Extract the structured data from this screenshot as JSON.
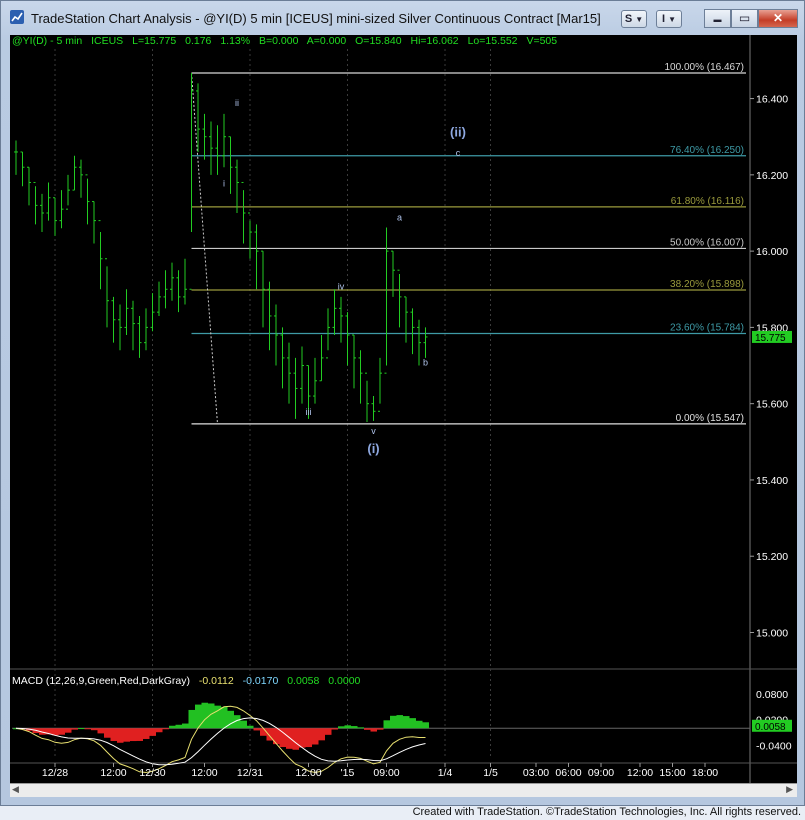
{
  "window": {
    "title": "TradeStation Chart Analysis - @YI(D) 5 min [ICEUS] mini-sized Silver Continuous Contract [Mar15]",
    "toolbar_s_label": "S",
    "toolbar_i_label": "I",
    "minimize_glyph": "▬",
    "maximize_glyph": "▭",
    "close_glyph": "✕"
  },
  "status": {
    "symbol": "@YI(D) - 5 min",
    "exchange": "ICEUS",
    "last": "L=15.775",
    "change": "0.176",
    "change_pct": "1.13%",
    "bid": "B=0.000",
    "ask": "A=0.000",
    "open": "O=15.840",
    "high": "Hi=16.062",
    "low": "Lo=15.552",
    "volume": "V=505"
  },
  "price_axis": {
    "ticks": [
      "16.400",
      "16.200",
      "16.000",
      "15.800",
      "15.600",
      "15.400",
      "15.200",
      "15.000"
    ],
    "tick_values": [
      16.4,
      16.2,
      16.0,
      15.8,
      15.6,
      15.4,
      15.2,
      15.0
    ],
    "ylim": [
      14.92,
      16.53
    ],
    "last_price_label": "15.775",
    "last_price_value": 15.775
  },
  "fib_levels": [
    {
      "label": "100.00% (16.467)",
      "value": 16.467,
      "color": "#d8d8d8"
    },
    {
      "label": "76.40% (16.250)",
      "value": 16.25,
      "color": "#3e9aa6"
    },
    {
      "label": "61.80% (16.116)",
      "value": 16.116,
      "color": "#9a9a3c"
    },
    {
      "label": "50.00% (16.007)",
      "value": 16.007,
      "color": "#c8c8c8"
    },
    {
      "label": "38.20% (15.898)",
      "value": 15.898,
      "color": "#9a9a3c"
    },
    {
      "label": "23.60% (15.784)",
      "value": 15.784,
      "color": "#3e9aa6"
    },
    {
      "label": "0.00% (15.547)",
      "value": 15.547,
      "color": "#e0e0e0"
    }
  ],
  "wave_labels": [
    {
      "text": "ii",
      "price": 16.38,
      "bar": 34
    },
    {
      "text": "i",
      "price": 16.17,
      "bar": 32
    },
    {
      "text": "iii",
      "price": 15.57,
      "bar": 45
    },
    {
      "text": "iv",
      "price": 15.9,
      "bar": 50
    },
    {
      "text": "v",
      "price": 15.52,
      "bar": 55
    },
    {
      "text": "(i)",
      "price": 15.47,
      "bar": 55
    },
    {
      "text": "a",
      "price": 16.08,
      "bar": 59
    },
    {
      "text": "b",
      "price": 15.7,
      "bar": 63
    },
    {
      "text": "(ii)",
      "price": 16.3,
      "bar": 68
    },
    {
      "text": "c",
      "price": 16.25,
      "bar": 68
    }
  ],
  "macd": {
    "label": "MACD (12,26,9,Green,Red,DarkGray)",
    "macd_value": "-0.0112",
    "signal_value": "-0.0170",
    "diff_value": "0.0058",
    "zero_value": "0.0000",
    "axis_ticks": [
      "0.0800",
      "0.0200",
      "-0.0400"
    ],
    "axis_tick_values": [
      0.08,
      0.02,
      -0.04
    ],
    "ylim": [
      -0.072,
      0.12
    ],
    "current_label": "0.0058",
    "current_value": 0.0058,
    "colors": {
      "macd": "#e8e070",
      "signal": "#ffffff",
      "positive": "#22c022",
      "negative": "#e02020"
    }
  },
  "time_axis": {
    "labels": [
      "12/28",
      "12:00",
      "12/30",
      "12:00",
      "12/31",
      "12:00",
      "'15",
      "09:00",
      "1/4",
      "1/5",
      "03:00",
      "06:00",
      "09:00",
      "12:00",
      "15:00",
      "18:00"
    ],
    "bar_positions": [
      6,
      15,
      21,
      29,
      36,
      45,
      51,
      57,
      66,
      73,
      80,
      85,
      90,
      96,
      101,
      106
    ]
  },
  "chart_data": {
    "type": "candlestick",
    "title": "@YI(D) 5 min [ICEUS] mini-sized Silver Continuous Contract [Mar15]",
    "bar_count": 112,
    "close": [
      16.26,
      16.22,
      16.18,
      16.12,
      16.1,
      16.14,
      16.08,
      16.11,
      16.16,
      16.22,
      16.2,
      16.13,
      16.08,
      15.98,
      15.87,
      15.82,
      15.8,
      15.85,
      15.81,
      15.76,
      15.8,
      15.84,
      15.88,
      15.9,
      15.93,
      15.88,
      15.9,
      16.42,
      16.32,
      16.3,
      16.27,
      16.25,
      16.3,
      16.22,
      16.18,
      16.1,
      16.05,
      16.0,
      15.9,
      15.83,
      15.78,
      15.72,
      15.68,
      15.64,
      15.7,
      15.62,
      15.66,
      15.72,
      15.8,
      15.85,
      15.83,
      15.78,
      15.72,
      15.68,
      15.6,
      15.58,
      15.68,
      16.0,
      15.95,
      15.88,
      15.84,
      15.8,
      15.76,
      15.775
    ],
    "high": [
      16.29,
      16.26,
      16.22,
      16.17,
      16.15,
      16.18,
      16.14,
      16.16,
      16.2,
      16.25,
      16.24,
      16.19,
      16.13,
      16.05,
      15.96,
      15.88,
      15.86,
      15.9,
      15.87,
      15.83,
      15.85,
      15.89,
      15.92,
      15.95,
      15.97,
      15.95,
      15.98,
      16.467,
      16.44,
      16.36,
      16.34,
      16.33,
      16.36,
      16.3,
      16.24,
      16.16,
      16.08,
      16.07,
      16.0,
      15.92,
      15.86,
      15.8,
      15.76,
      15.72,
      15.75,
      15.7,
      15.72,
      15.78,
      15.85,
      15.9,
      15.88,
      15.84,
      15.78,
      15.74,
      15.66,
      15.62,
      15.72,
      16.062,
      16.0,
      15.94,
      15.88,
      15.85,
      15.82,
      15.8
    ],
    "low": [
      16.2,
      16.17,
      16.12,
      16.07,
      16.05,
      16.08,
      16.04,
      16.06,
      16.12,
      16.16,
      16.14,
      16.07,
      16.02,
      15.9,
      15.8,
      15.76,
      15.74,
      15.78,
      15.74,
      15.72,
      15.74,
      15.79,
      15.83,
      15.85,
      15.87,
      15.84,
      15.86,
      16.05,
      16.26,
      16.24,
      16.2,
      16.2,
      16.22,
      16.15,
      16.1,
      16.02,
      15.98,
      15.9,
      15.8,
      15.74,
      15.7,
      15.64,
      15.6,
      15.56,
      15.6,
      15.56,
      15.6,
      15.66,
      15.74,
      15.78,
      15.76,
      15.7,
      15.64,
      15.6,
      15.552,
      15.555,
      15.6,
      15.7,
      15.88,
      15.8,
      15.76,
      15.73,
      15.7,
      15.72
    ],
    "xlabel": "",
    "ylabel": ""
  }
}
